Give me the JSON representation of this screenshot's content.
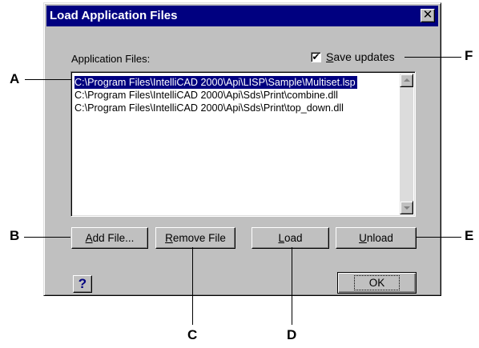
{
  "dialog": {
    "title": "Load Application Files",
    "close_glyph": "✕",
    "app_files_label": "Application Files:",
    "save_updates": {
      "prefix": "S",
      "rest": "ave updates",
      "checked_glyph": "✔"
    },
    "files": [
      "C:\\Program Files\\IntelliCAD 2000\\Api\\LISP\\Sample\\Multiset.lsp",
      "C:\\Program Files\\IntelliCAD 2000\\Api\\Sds\\Print\\combine.dll",
      "C:\\Program Files\\IntelliCAD 2000\\Api\\Sds\\Print\\top_down.dll"
    ],
    "buttons": {
      "add_file": {
        "prefix": "A",
        "rest": "dd File..."
      },
      "remove_file": {
        "prefix": "R",
        "rest": "emove File"
      },
      "load": {
        "prefix": "L",
        "rest": "oad"
      },
      "unload": {
        "prefix": "U",
        "rest": "nload"
      },
      "ok": "OK"
    },
    "help_glyph": "?"
  },
  "callouts": {
    "a": "A",
    "b": "B",
    "c": "C",
    "d": "D",
    "e": "E",
    "f": "F"
  },
  "colors": {
    "titlebar": "#000080",
    "face": "#c0c0c0",
    "selection": "#000080"
  }
}
